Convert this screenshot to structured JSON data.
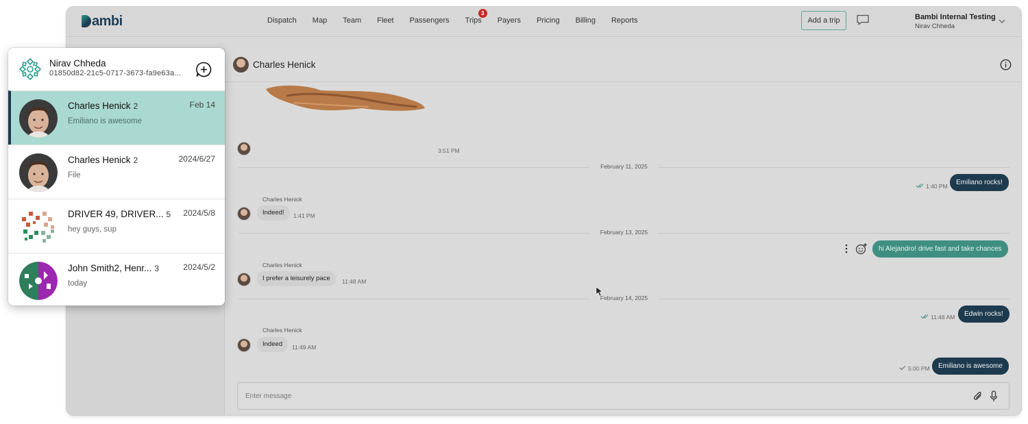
{
  "topbar": {
    "logo": "ambi",
    "nav": [
      "Dispatch",
      "Map",
      "Team",
      "Fleet",
      "Passengers",
      "Trips",
      "Payers",
      "Pricing",
      "Billing",
      "Reports"
    ],
    "trips_badge": "3",
    "add_trip": "Add a trip",
    "org_name": "Bambi Internal Testing",
    "org_user": "Nirav Chheda"
  },
  "chat": {
    "header_name": "Charles Henick",
    "messages": {
      "t1": "3:51 PM",
      "date1": "February 11, 2025",
      "out1": "Emiliano rocks!",
      "out1_time": "1:40 PM",
      "sender1": "Charles Henick",
      "in1": "Indeed!",
      "in1_time": "1:41 PM",
      "date2": "February 13, 2025",
      "out2": "hi Alejandro! drive fast and take chances",
      "sender2": "Charles Henick",
      "in2": "I prefer a leisurely pace",
      "in2_time": "11:48 AM",
      "date3": "February 14, 2025",
      "out3": "Edwin rocks!",
      "out3_time": "11:48 AM",
      "sender3": "Charles Henick",
      "in3": "Indeed",
      "in3_time": "11:49 AM",
      "out4": "Emiliano is awesome",
      "out4_time": "5:00 PM"
    },
    "composer_placeholder": "Enter message"
  },
  "popup": {
    "user_name": "Nirav Chheda",
    "user_id": "01850d82-21c5-0717-3673-fa9e63a...",
    "conversations": [
      {
        "name": "Charles Henick",
        "count": "2",
        "date": "Feb 14",
        "preview": "Emiliano is awesome"
      },
      {
        "name": "Charles Henick",
        "count": "2",
        "date": "2024/6/27",
        "preview": "File"
      },
      {
        "name": "DRIVER 49, DRIVER...",
        "count": "5",
        "date": "2024/5/8",
        "preview": "hey guys, sup"
      },
      {
        "name": "John Smith2, Henr...",
        "count": "3",
        "date": "2024/5/2",
        "preview": "today"
      }
    ]
  },
  "colors": {
    "brand_dark": "#1d3a4e",
    "accent_teal": "#3f8f81",
    "active_row": "#a9d9d1",
    "badge_red": "#c62828"
  },
  "icons": [
    "chat-bubble-icon",
    "chevron-down-icon",
    "info-icon",
    "emoji-add-icon",
    "more-vertical-icon",
    "paperclip-icon",
    "microphone-icon",
    "compose-plus-icon",
    "read-check-icon",
    "cursor-arrow-icon"
  ]
}
